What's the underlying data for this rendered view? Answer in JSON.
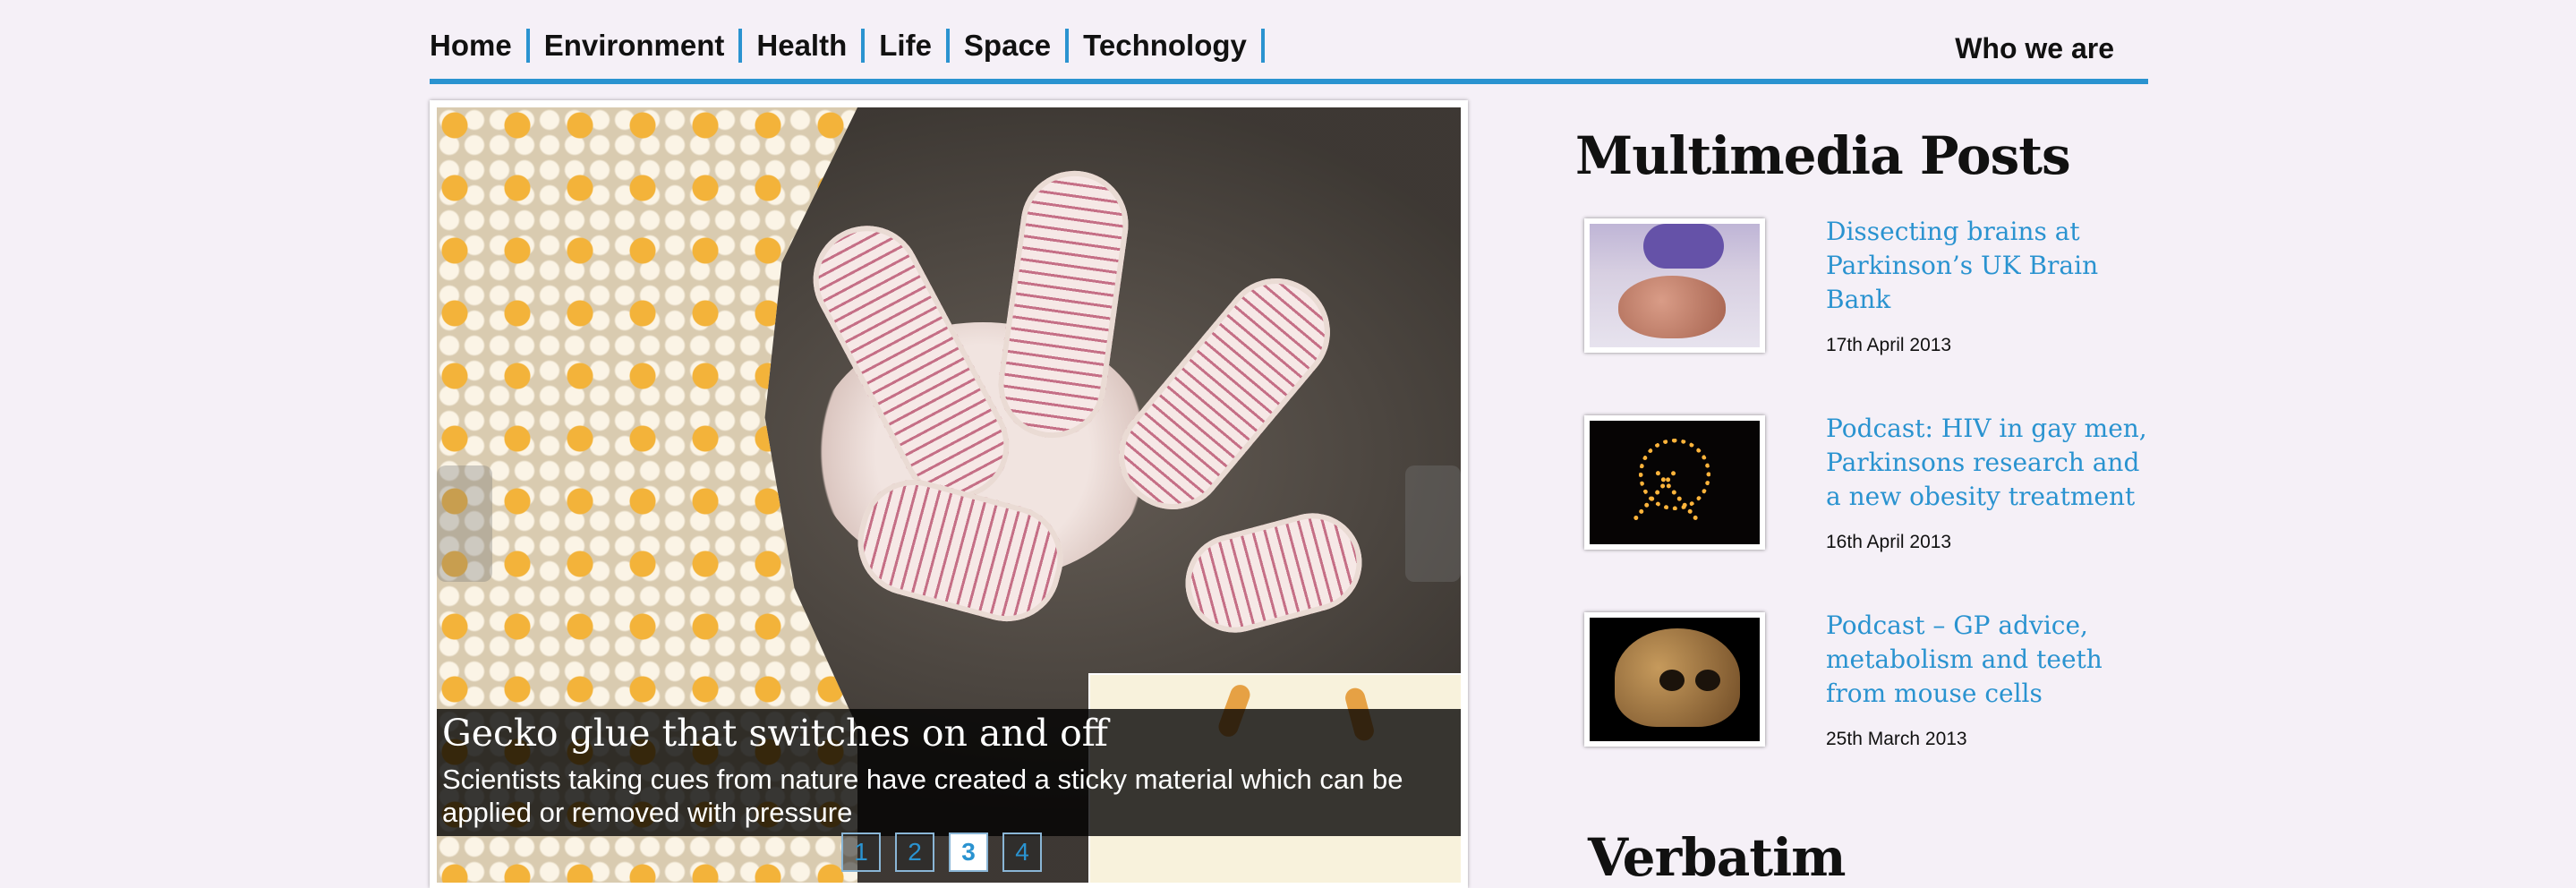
{
  "nav": {
    "items": [
      {
        "label": "Home"
      },
      {
        "label": "Environment"
      },
      {
        "label": "Health"
      },
      {
        "label": "Life"
      },
      {
        "label": "Space"
      },
      {
        "label": "Technology"
      }
    ],
    "right_link": "Who we are",
    "accent_color": "#2a93d0"
  },
  "slider": {
    "caption_title": "Gecko glue that switches on and off",
    "caption_text": "Scientists taking cues from nature have created a sticky material which can be applied or removed with pressure",
    "pages": [
      "1",
      "2",
      "3",
      "4"
    ],
    "active_page": "3",
    "image_subject": "gecko foot"
  },
  "sidebar": {
    "title": "Multimedia Posts",
    "posts": [
      {
        "title": "Dissecting brains at Parkinson’s UK Brain Bank",
        "date": "17th April 2013",
        "thumb": "brain"
      },
      {
        "title": "Podcast: HIV in gay men, Parkinsons research and a new obesity treatment",
        "date": "16th April 2013",
        "thumb": "ribbon"
      },
      {
        "title": "Podcast – GP advice, metabolism and teeth from mouse cells",
        "date": "25th March 2013",
        "thumb": "skull"
      }
    ],
    "next_section_title": "Verbatim"
  }
}
